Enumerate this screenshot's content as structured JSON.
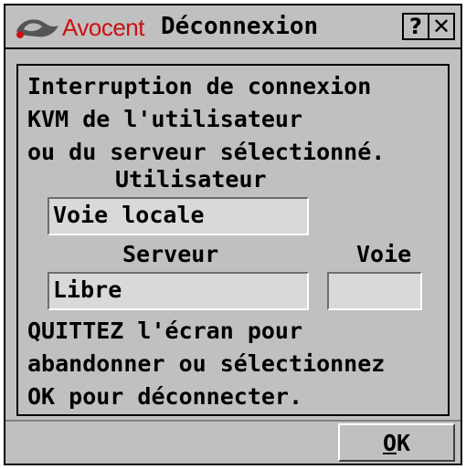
{
  "window": {
    "brand": "Avocent",
    "title": "Déconnexion",
    "help_label": "?",
    "close_label": "✕"
  },
  "message": {
    "line1": "Interruption de connexion",
    "line2": "KVM de l'utilisateur",
    "line3": "ou du serveur sélectionné."
  },
  "labels": {
    "user": "Utilisateur",
    "server": "Serveur",
    "channel": "Voie"
  },
  "fields": {
    "user_value": "Voie locale",
    "server_value": "Libre",
    "channel_value": ""
  },
  "instructions": {
    "line1": "QUITTEZ l'écran pour",
    "line2": "abandonner ou sélectionnez",
    "line3": "OK pour déconnecter."
  },
  "buttons": {
    "ok_first": "O",
    "ok_rest": "K"
  },
  "colors": {
    "brand": "#cc1111",
    "background": "#c0c0c0"
  }
}
